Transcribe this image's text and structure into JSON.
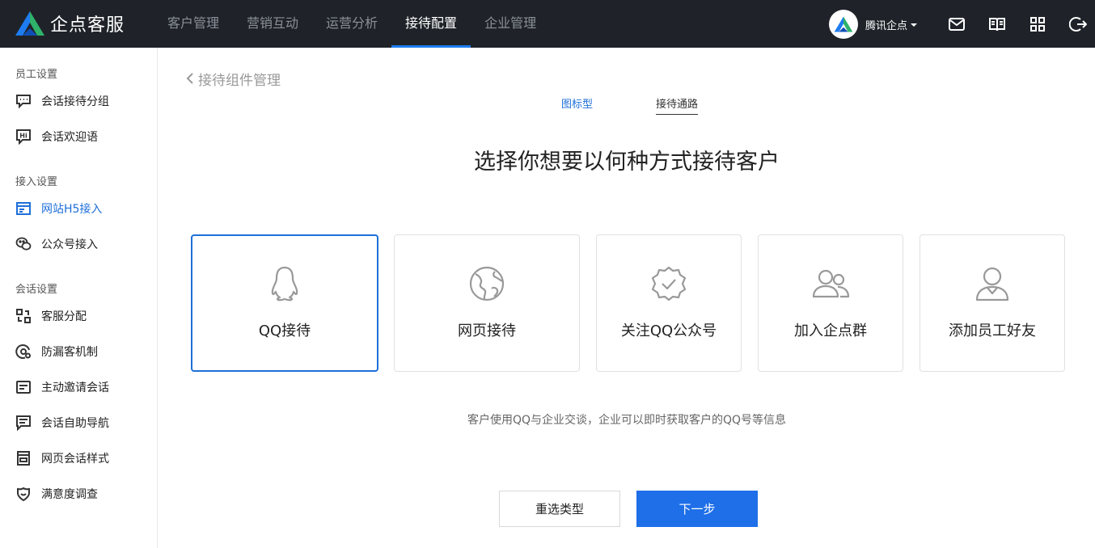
{
  "app": {
    "name": "企点客服"
  },
  "nav": {
    "items": [
      {
        "label": "客户管理"
      },
      {
        "label": "营销互动"
      },
      {
        "label": "运营分析"
      },
      {
        "label": "接待配置"
      },
      {
        "label": "企业管理"
      }
    ],
    "active": "接待配置"
  },
  "user": {
    "name": "腾讯企点"
  },
  "sidebar": {
    "sections": [
      {
        "title": "员工设置"
      },
      {
        "title": "接入设置"
      },
      {
        "title": "会话设置"
      }
    ],
    "items": [
      {
        "label": "会话接待分组",
        "icon": "chat-group-icon"
      },
      {
        "label": "会话欢迎语",
        "icon": "hi-icon"
      },
      {
        "label": "网站H5接入",
        "icon": "website-icon",
        "active": true
      },
      {
        "label": "公众号接入",
        "icon": "wechat-icon"
      },
      {
        "label": "客服分配",
        "icon": "distribution-icon"
      },
      {
        "label": "防漏客机制",
        "icon": "anti-loss-icon"
      },
      {
        "label": "主动邀请会话",
        "icon": "invite-icon"
      },
      {
        "label": "会话自助导航",
        "icon": "navigation-icon"
      },
      {
        "label": "网页会话样式",
        "icon": "web-style-icon"
      },
      {
        "label": "满意度调查",
        "icon": "satisfaction-icon"
      }
    ]
  },
  "main": {
    "back_label": "接待组件管理",
    "tabs": [
      {
        "label": "图标型"
      },
      {
        "label": "接待通路"
      }
    ],
    "heading": "选择你想要以何种方式接待客户",
    "cards": [
      {
        "label": "QQ接待",
        "icon": "qq-penguin-icon",
        "selected": true
      },
      {
        "label": "网页接待",
        "icon": "globe-icon"
      },
      {
        "label": "关注QQ公众号",
        "icon": "verified-badge-icon"
      },
      {
        "label": "加入企点群",
        "icon": "group-icon"
      },
      {
        "label": "添加员工好友",
        "icon": "staff-icon"
      }
    ],
    "description": "客户使用QQ与企业交谈，企业可以即时获取客户的QQ号等信息",
    "buttons": {
      "reset": "重选类型",
      "next": "下一步"
    }
  },
  "colors": {
    "accent": "#1e6fd9",
    "topbar": "#1f2329",
    "primary_button": "#1e6fe8"
  }
}
